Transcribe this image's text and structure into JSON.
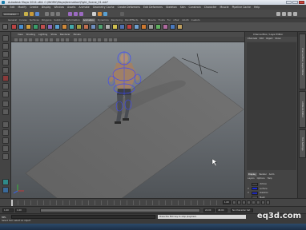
{
  "window": {
    "title": "Autodesk Maya 2014 x64: C:\\WORK\\Maya\\Animation\\Fight_Scene_01.mb*"
  },
  "menubar": {
    "items": [
      "File",
      "Edit",
      "Modify",
      "Create",
      "Display",
      "Window",
      "Assets",
      "Animate",
      "Geometry Cache",
      "Create Deformers",
      "Edit Deformers",
      "Skeleton",
      "Skin",
      "Constrain",
      "Character",
      "Muscle",
      "Pipeline Cache",
      "Help"
    ]
  },
  "status_line": {
    "mode": "Animation"
  },
  "shelf": {
    "tabs": [
      "General",
      "Curves",
      "Surfaces",
      "Polygons",
      "Subdiv s",
      "Deformation",
      "Animation",
      "Dynamics",
      "Rendering",
      "PaintEffects",
      "Toon",
      "Muscle",
      "Fluids",
      "Fur",
      "nHair",
      "nCloth",
      "Custom"
    ],
    "active_tab": "Animation"
  },
  "viewport": {
    "menu": [
      "View",
      "Shading",
      "Lighting",
      "Show",
      "Renderer",
      "Panels"
    ]
  },
  "channel_box": {
    "header": "Channel Box / Layer Editor",
    "menu": [
      "Channels",
      "Edit",
      "Object",
      "Show"
    ]
  },
  "layers": {
    "tabs": [
      "Display",
      "Render",
      "Anim"
    ],
    "active_tab": "Display",
    "menu": [
      "Layers",
      "Options",
      "Help"
    ],
    "rows": [
      {
        "vis": "",
        "name": "ctrlbox",
        "color": "#454545"
      },
      {
        "vis": "V",
        "name": "surface",
        "color": "#1a2bd8"
      },
      {
        "vis": "V",
        "name": "skeleton",
        "color": "#1e28b8"
      },
      {
        "vis": "",
        "name": "Mesh",
        "color": "#4b4b4b"
      }
    ]
  },
  "right_strip": {
    "tabs": [
      "Channel Box / Layer Editor",
      "Attribute Editor",
      "Tool Settings"
    ]
  },
  "range": {
    "start": "1.00",
    "end": "24.00",
    "current": "1.00",
    "anim_end": "48.00",
    "character_set": "No Character Set"
  },
  "command_line": {
    "label": "MEL",
    "result": "Press the ESC key to stop playblast."
  },
  "help_line": {
    "text": "Select Tool: select an object"
  },
  "watermark": {
    "text": "eq3d.com"
  }
}
